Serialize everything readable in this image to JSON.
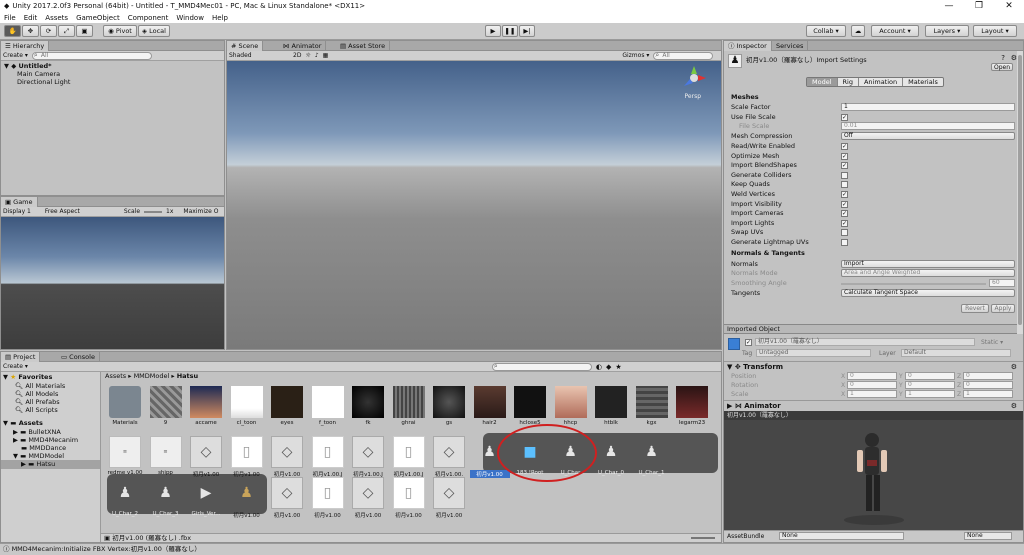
{
  "window": {
    "title": "Unity 2017.2.0f3 Personal (64bit) - Untitled - T_MMD4Mec01 - PC, Mac & Linux Standalone* <DX11>"
  },
  "menu": [
    "File",
    "Edit",
    "Assets",
    "GameObject",
    "Component",
    "Window",
    "Help"
  ],
  "toolbar": {
    "pivot": "Pivot",
    "local": "Local",
    "collab": "Collab ▾",
    "account": "Account",
    "layers": "Layers",
    "layout": "Layout"
  },
  "hierarchy": {
    "tab": "Hierarchy",
    "create": "Create ▾",
    "search": "All",
    "scene": "Untitled*",
    "items": [
      "Main Camera",
      "Directional Light"
    ]
  },
  "scene": {
    "tabs": [
      "Scene",
      "Animator",
      "Asset Store"
    ],
    "shading": "Shaded",
    "mode2d": "2D",
    "gizmos": "Gizmos ▾",
    "search": "All",
    "persp": "Persp"
  },
  "game": {
    "tab": "Game",
    "display": "Display 1",
    "aspect": "Free Aspect",
    "scale_label": "Scale",
    "scale_value": "1x",
    "maximize": "Maximize O"
  },
  "project": {
    "tabs": [
      "Project",
      "Console"
    ],
    "create": "Create ▾",
    "favorites": {
      "title": "Favorites",
      "items": [
        "All Materials",
        "All Models",
        "All Prefabs",
        "All Scripts"
      ]
    },
    "assets": {
      "title": "Assets",
      "items": [
        "BulletXNA",
        "MMD4Mecanim",
        "MMDDance",
        "MMDModel",
        "Hatsu"
      ]
    },
    "breadcrumb": [
      "Assets",
      "MMDModel",
      "Hatsu"
    ],
    "row1": [
      "Materials",
      "9",
      "accame",
      "cl_toon",
      "eyes",
      "f_toon",
      "fk",
      "ghrai",
      "gs",
      "hair2",
      "hclose5",
      "hhcp",
      "htblk",
      "kgx",
      "legarm23"
    ],
    "row2": [
      "redme v1.00",
      "shipp",
      "初月v1.00",
      "初月v1.00",
      "初月v1.00",
      "初月v1.00.J",
      "初月v1.00.J",
      "初月v1.00.J",
      "初月v1.00.",
      "初月v1.00",
      "183.!Root",
      "U_Char",
      "U_Char_0",
      "U_Char_1"
    ],
    "row3": [
      "U_Char_2",
      "U_Char_3",
      "Girls_Ver...",
      "初月v1.00",
      "初月v1.00",
      "初月v1.00",
      "初月v1.00",
      "初月v1.00",
      "初月v1.00"
    ],
    "selected_path": "初月v1.00 (羅寡なし) .fbx"
  },
  "inspector": {
    "tabs": [
      "Inspector",
      "Services"
    ],
    "title": "初月v1.00（羅寡なし）Import Settings",
    "open": "Open",
    "subtabs": [
      "Model",
      "Rig",
      "Animation",
      "Materials"
    ],
    "meshes": "Meshes",
    "scale_factor": "Scale Factor",
    "scale_factor_val": "1",
    "use_file_scale": "Use File Scale",
    "file_scale": "File Scale",
    "file_scale_val": "0.01",
    "mesh_compression": "Mesh Compression",
    "mesh_compression_val": "Off",
    "checks": [
      "Read/Write Enabled",
      "Optimize Mesh",
      "Import BlendShapes",
      "Generate Colliders",
      "Keep Quads",
      "Weld Vertices",
      "Import Visibility",
      "Import Cameras",
      "Import Lights",
      "Swap UVs",
      "Generate Lightmap UVs"
    ],
    "checks_state": [
      true,
      true,
      true,
      false,
      false,
      true,
      true,
      true,
      true,
      false,
      false
    ],
    "normals_section": "Normals & Tangents",
    "normals": "Normals",
    "normals_val": "Import",
    "normals_mode": "Normals Mode",
    "normals_mode_val": "Area and Angle Weighted",
    "smoothing": "Smoothing Angle",
    "smoothing_val": "60",
    "tangents": "Tangents",
    "tangents_val": "Calculate Tangent Space",
    "revert": "Revert",
    "apply": "Apply",
    "imported_object": "Imported Object",
    "obj_name": "初月v1.00（羅寡なし）",
    "static": "Static ▾",
    "tag_label": "Tag",
    "tag_val": "Untagged",
    "layer_label": "Layer",
    "layer_val": "Default",
    "transform": "Transform",
    "position": "Position",
    "rotation": "Rotation",
    "scale": "Scale",
    "pos": [
      "0",
      "0",
      "0"
    ],
    "rot": [
      "0",
      "0",
      "0"
    ],
    "scl": [
      "1",
      "1",
      "1"
    ],
    "animator": "Animator",
    "preview_name": "初月v1.00（羅寡なし）",
    "asset_bundle": "AssetBundle",
    "ab_val": "None",
    "ab_val2": "None"
  },
  "status": {
    "text": "MMD4Mecanim:Initialize FBX Vertex:初月v1.00（羅寡なし）"
  }
}
